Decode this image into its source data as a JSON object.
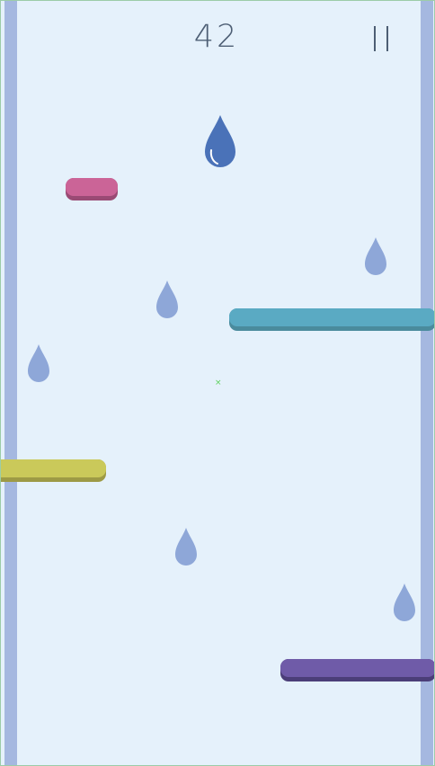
{
  "game": {
    "score": "42",
    "pause_icon": "pause-icon",
    "player_icon": "water-drop-icon",
    "raindrop_icon": "raindrop-icon",
    "marker_glyph": "×"
  },
  "colors": {
    "background": "#e5f1fb",
    "wall": "#a5b8e0",
    "player": "#4a72b8",
    "raindrop": "#8ea7d8",
    "platform_pink": "#cb6497",
    "platform_teal": "#5aaac3",
    "platform_yellow": "#cac95a",
    "platform_purple": "#6f5ba8"
  },
  "platforms": [
    {
      "name": "platform-pink",
      "color": "#cb6497"
    },
    {
      "name": "platform-teal",
      "color": "#5aaac3"
    },
    {
      "name": "platform-yellow",
      "color": "#cac95a"
    },
    {
      "name": "platform-purple",
      "color": "#6f5ba8"
    }
  ]
}
